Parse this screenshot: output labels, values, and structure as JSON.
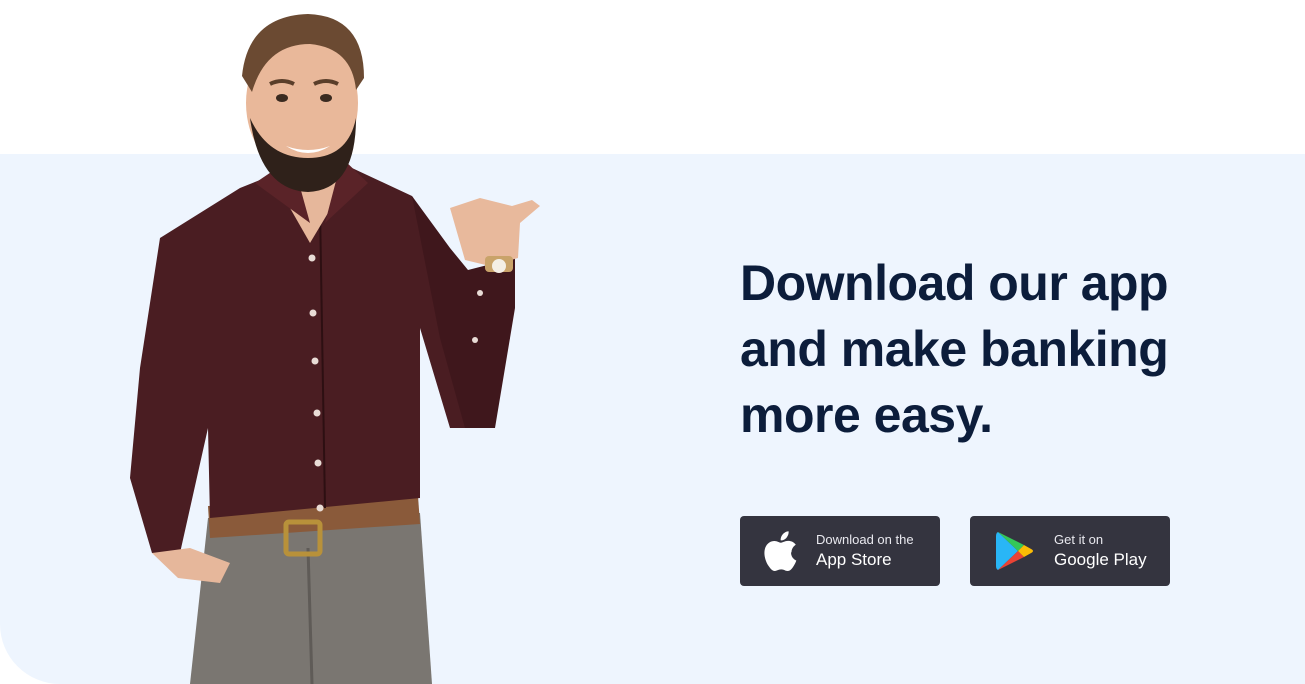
{
  "headline": {
    "line1": "Download our app",
    "line2": "and make banking",
    "line3": "more easy."
  },
  "app_store": {
    "small": "Download on the",
    "big": "App Store",
    "icon": "apple-icon"
  },
  "google_play": {
    "small": "Get it on",
    "big": "Google Play",
    "icon": "google-play-icon"
  },
  "colors": {
    "band_bg": "#eef5fe",
    "headline": "#0c1d3b",
    "button_bg": "#34343f",
    "shirt": "#4a1d22",
    "trousers": "#77736f",
    "belt": "#8a5a3a"
  }
}
